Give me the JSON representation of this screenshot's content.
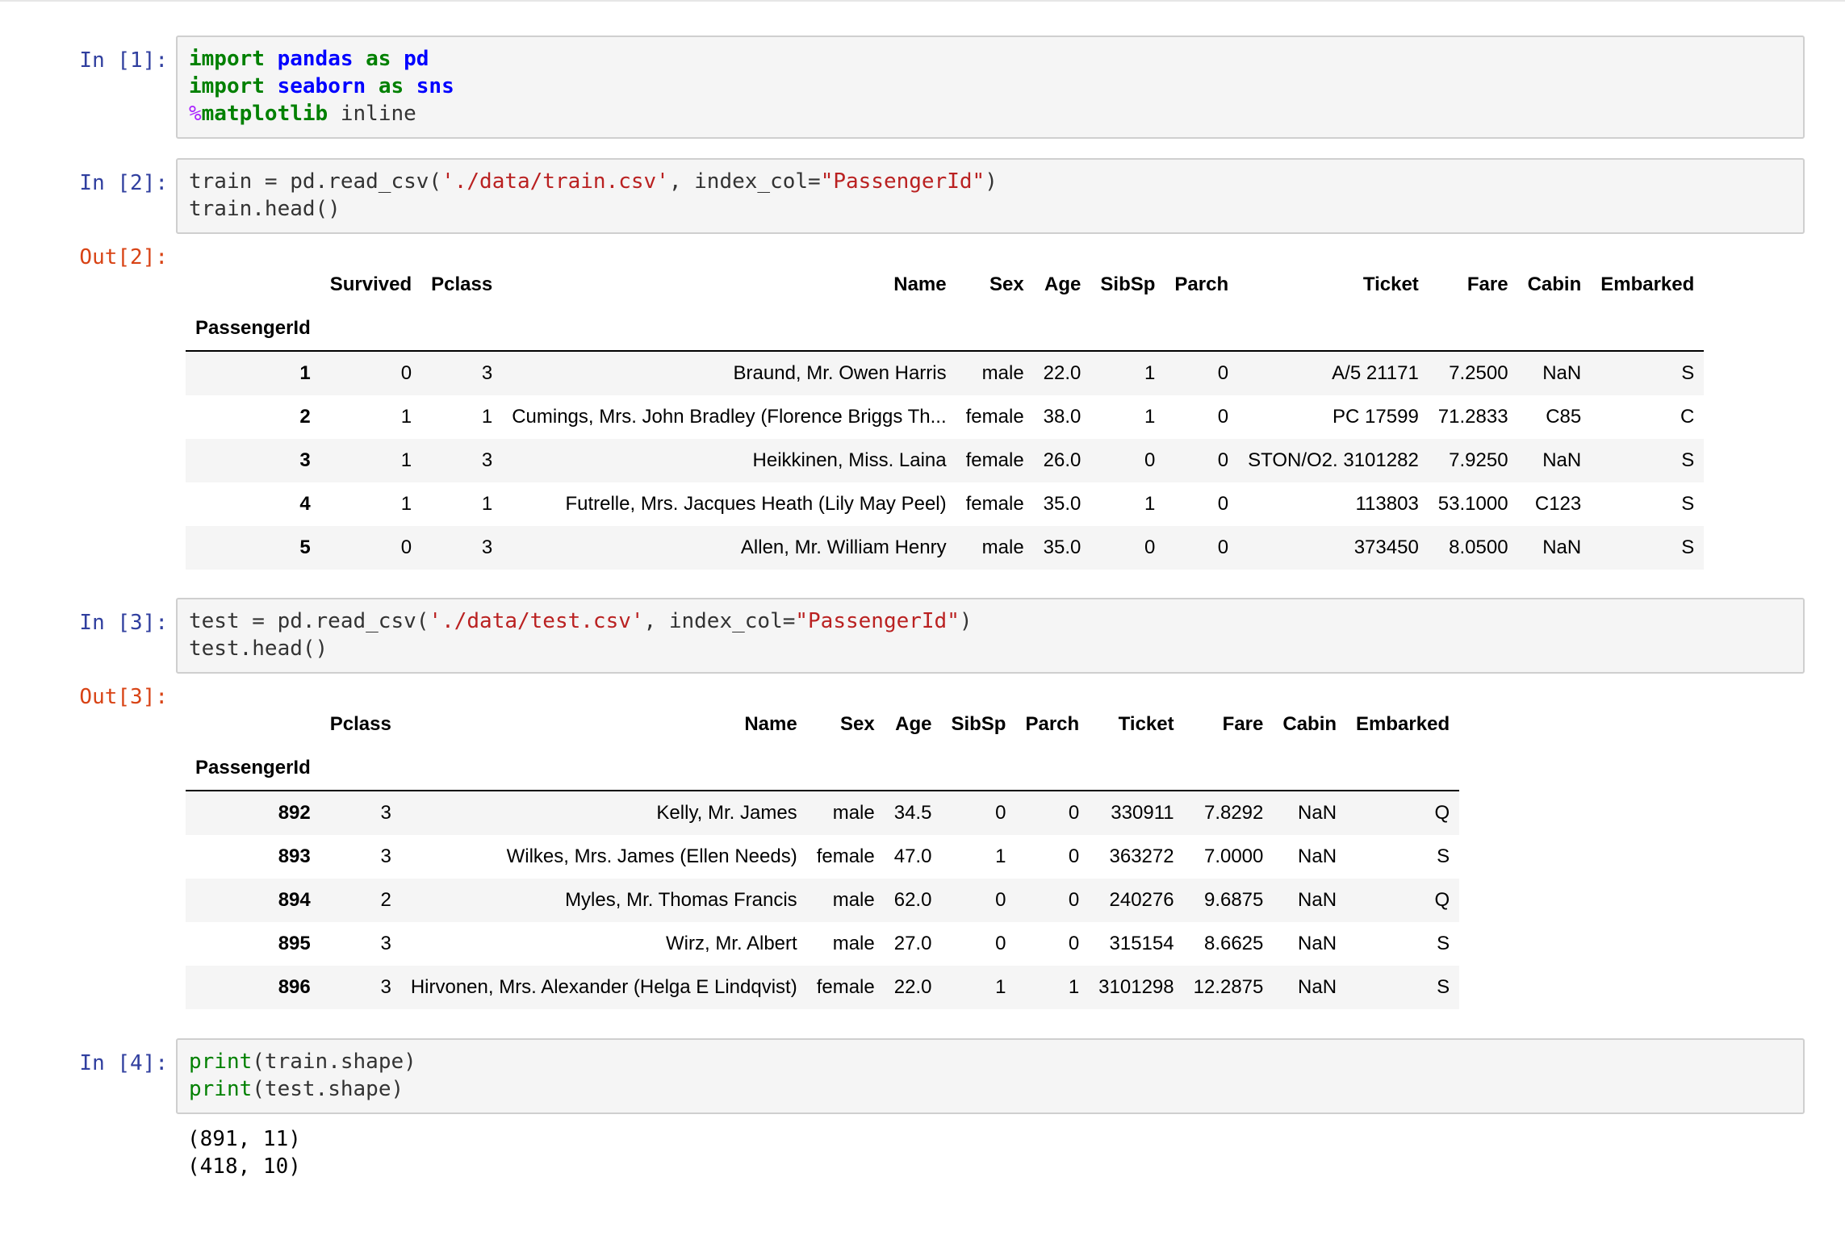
{
  "cells": {
    "c1": {
      "prompt": "In [1]:",
      "lines": [
        [
          [
            "kw",
            "import"
          ],
          [
            "p",
            " "
          ],
          [
            "mod",
            "pandas"
          ],
          [
            "p",
            " "
          ],
          [
            "kw",
            "as"
          ],
          [
            "p",
            " "
          ],
          [
            "mod",
            "pd"
          ]
        ],
        [
          [
            "kw",
            "import"
          ],
          [
            "p",
            " "
          ],
          [
            "mod",
            "seaborn"
          ],
          [
            "p",
            " "
          ],
          [
            "kw",
            "as"
          ],
          [
            "p",
            " "
          ],
          [
            "mod",
            "sns"
          ]
        ],
        [
          [
            "magic-pct",
            "%"
          ],
          [
            "kw",
            "matplotlib"
          ],
          [
            "p",
            " inline"
          ]
        ]
      ]
    },
    "c2": {
      "prompt": "In [2]:",
      "out_prompt": "Out[2]:",
      "lines": [
        [
          [
            "p",
            "train = pd.read_csv("
          ],
          [
            "str",
            "'./data/train.csv'"
          ],
          [
            "p",
            ", index_col="
          ],
          [
            "str",
            "\"PassengerId\""
          ],
          [
            "p",
            ")"
          ]
        ],
        [
          [
            "p",
            "train.head()"
          ]
        ]
      ],
      "table": {
        "index_name": "PassengerId",
        "columns": [
          "Survived",
          "Pclass",
          "Name",
          "Sex",
          "Age",
          "SibSp",
          "Parch",
          "Ticket",
          "Fare",
          "Cabin",
          "Embarked"
        ],
        "rows": [
          [
            "1",
            "0",
            "3",
            "Braund, Mr. Owen Harris",
            "male",
            "22.0",
            "1",
            "0",
            "A/5 21171",
            "7.2500",
            "NaN",
            "S"
          ],
          [
            "2",
            "1",
            "1",
            "Cumings, Mrs. John Bradley (Florence Briggs Th...",
            "female",
            "38.0",
            "1",
            "0",
            "PC 17599",
            "71.2833",
            "C85",
            "C"
          ],
          [
            "3",
            "1",
            "3",
            "Heikkinen, Miss. Laina",
            "female",
            "26.0",
            "0",
            "0",
            "STON/O2. 3101282",
            "7.9250",
            "NaN",
            "S"
          ],
          [
            "4",
            "1",
            "1",
            "Futrelle, Mrs. Jacques Heath (Lily May Peel)",
            "female",
            "35.0",
            "1",
            "0",
            "113803",
            "53.1000",
            "C123",
            "S"
          ],
          [
            "5",
            "0",
            "3",
            "Allen, Mr. William Henry",
            "male",
            "35.0",
            "0",
            "0",
            "373450",
            "8.0500",
            "NaN",
            "S"
          ]
        ]
      }
    },
    "c3": {
      "prompt": "In [3]:",
      "out_prompt": "Out[3]:",
      "lines": [
        [
          [
            "p",
            "test = pd.read_csv("
          ],
          [
            "str",
            "'./data/test.csv'"
          ],
          [
            "p",
            ", index_col="
          ],
          [
            "str",
            "\"PassengerId\""
          ],
          [
            "p",
            ")"
          ]
        ],
        [
          [
            "p",
            "test.head()"
          ]
        ]
      ],
      "table": {
        "index_name": "PassengerId",
        "columns": [
          "Pclass",
          "Name",
          "Sex",
          "Age",
          "SibSp",
          "Parch",
          "Ticket",
          "Fare",
          "Cabin",
          "Embarked"
        ],
        "rows": [
          [
            "892",
            "3",
            "Kelly, Mr. James",
            "male",
            "34.5",
            "0",
            "0",
            "330911",
            "7.8292",
            "NaN",
            "Q"
          ],
          [
            "893",
            "3",
            "Wilkes, Mrs. James (Ellen Needs)",
            "female",
            "47.0",
            "1",
            "0",
            "363272",
            "7.0000",
            "NaN",
            "S"
          ],
          [
            "894",
            "2",
            "Myles, Mr. Thomas Francis",
            "male",
            "62.0",
            "0",
            "0",
            "240276",
            "9.6875",
            "NaN",
            "Q"
          ],
          [
            "895",
            "3",
            "Wirz, Mr. Albert",
            "male",
            "27.0",
            "0",
            "0",
            "315154",
            "8.6625",
            "NaN",
            "S"
          ],
          [
            "896",
            "3",
            "Hirvonen, Mrs. Alexander (Helga E Lindqvist)",
            "female",
            "22.0",
            "1",
            "1",
            "3101298",
            "12.2875",
            "NaN",
            "S"
          ]
        ]
      }
    },
    "c4": {
      "prompt": "In [4]:",
      "lines": [
        [
          [
            "fn",
            "print"
          ],
          [
            "p",
            "(train.shape)"
          ]
        ],
        [
          [
            "fn",
            "print"
          ],
          [
            "p",
            "(test.shape)"
          ]
        ]
      ],
      "stdout": [
        "(891, 11)",
        "(418, 10)"
      ]
    }
  },
  "colors": {
    "in_prompt": "#303f9f",
    "out_prompt": "#d84315",
    "keyword": "#008000",
    "module": "#0000ff",
    "string": "#ba2121",
    "code_bg": "#f5f5f5",
    "row_stripe": "#f5f5f5"
  }
}
